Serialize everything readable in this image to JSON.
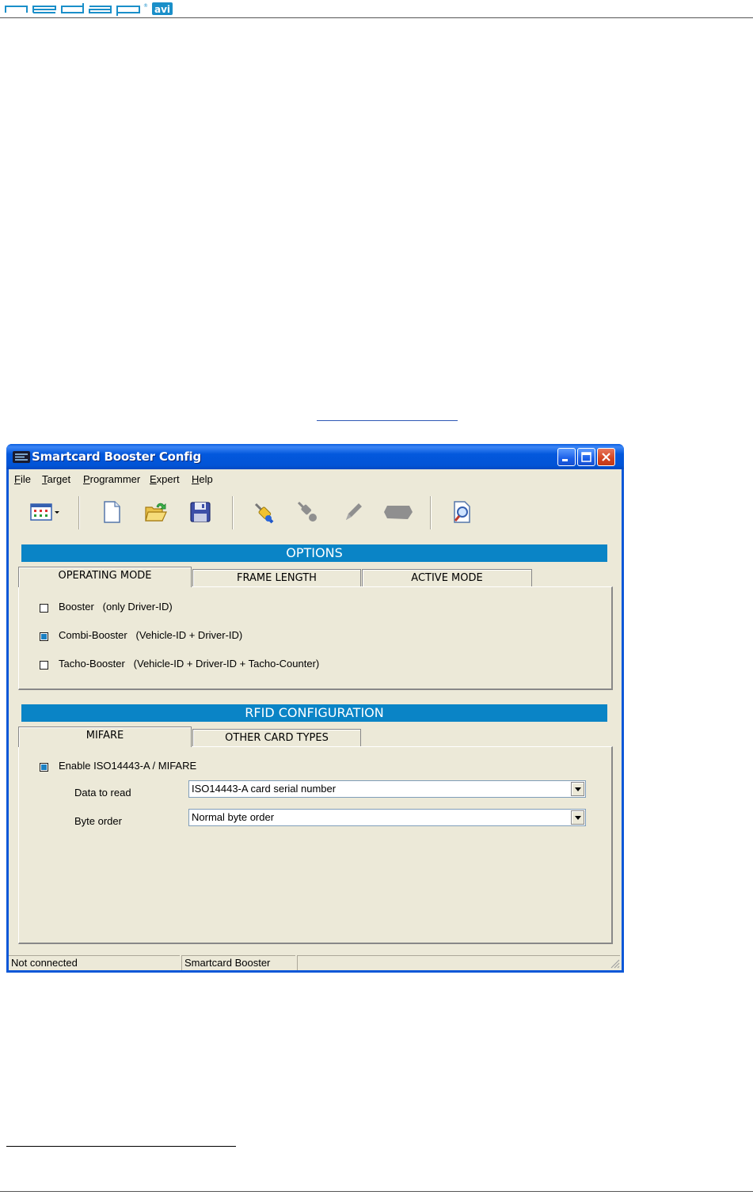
{
  "header": {
    "logo_text": "nedap",
    "logo_badge": "avi"
  },
  "window": {
    "title": "Smartcard Booster Config",
    "caption_buttons": [
      "minimize-icon",
      "maximize-icon",
      "close-icon"
    ]
  },
  "menu": [
    "File",
    "Target",
    "Programmer",
    "Expert",
    "Help"
  ],
  "menu_accel": [
    "F",
    "T",
    "P",
    "E",
    "H"
  ],
  "toolbar": [
    "view-menu-icon",
    "new-file-icon",
    "open-folder-icon",
    "save-disk-icon",
    "connect-plug-icon",
    "disconnect-plug-icon",
    "write-pen-icon",
    "card-icon",
    "preview-magnifier-icon"
  ],
  "options": {
    "title": "OPTIONS",
    "tabs": [
      "OPERATING MODE",
      "FRAME LENGTH",
      "ACTIVE MODE"
    ],
    "active_tab": 0,
    "items": [
      {
        "label": "Booster   (only Driver-ID)",
        "checked": false
      },
      {
        "label": "Combi-Booster   (Vehicle-ID + Driver-ID)",
        "checked": true
      },
      {
        "label": "Tacho-Booster   (Vehicle-ID + Driver-ID + Tacho-Counter)",
        "checked": false
      }
    ]
  },
  "rfid": {
    "title": "RFID CONFIGURATION",
    "tabs": [
      "MIFARE",
      "OTHER CARD TYPES"
    ],
    "active_tab": 0,
    "enable_label": "Enable ISO14443-A / MIFARE",
    "enable_checked": true,
    "data_to_read_label": "Data to read",
    "data_to_read_value": "ISO14443-A card serial number",
    "byte_order_label": "Byte order",
    "byte_order_value": "Normal byte order"
  },
  "status": {
    "connection": "Not connected",
    "device": "Smartcard Booster",
    "extra": ""
  },
  "colors": {
    "titlebar": "#0358dd",
    "section_bar": "#0a84c6",
    "face": "#ece9d8",
    "logo": "#1a8fc9"
  }
}
